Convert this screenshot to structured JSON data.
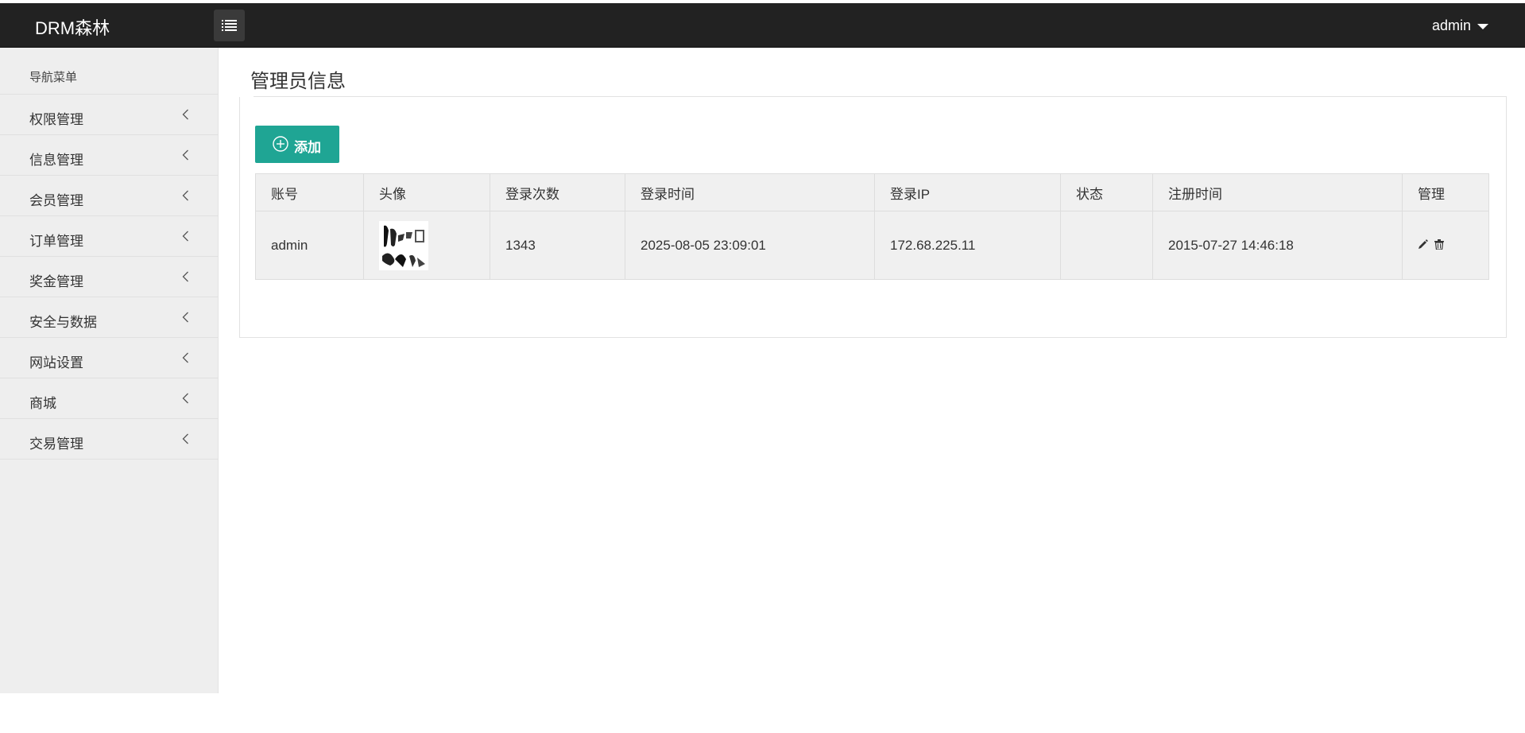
{
  "app": {
    "brand": "DRM森林",
    "user": "admin"
  },
  "sidebar": {
    "header": "导航菜单",
    "items": [
      {
        "label": "权限管理"
      },
      {
        "label": "信息管理"
      },
      {
        "label": "会员管理"
      },
      {
        "label": "订单管理"
      },
      {
        "label": "奖金管理"
      },
      {
        "label": "安全与数据"
      },
      {
        "label": "网站设置"
      },
      {
        "label": "商城"
      },
      {
        "label": "交易管理"
      }
    ]
  },
  "main": {
    "title": "管理员信息",
    "add_label": "添加",
    "table": {
      "headers": [
        "账号",
        "头像",
        "登录次数",
        "登录时间",
        "登录IP",
        "状态",
        "注册时间",
        "管理"
      ],
      "rows": [
        {
          "account": "admin",
          "avatar": "",
          "login_count": "1343",
          "login_time": "2025-08-05 23:09:01",
          "login_ip": "172.68.225.11",
          "status": "",
          "register_time": "2015-07-27 14:46:18"
        }
      ]
    }
  },
  "icons": [
    "menu-toggle-icon",
    "caret-down-icon",
    "chevron-left-icon",
    "plus-circle-icon",
    "pencil-icon",
    "trash-icon"
  ],
  "colors": {
    "topbar": "#222222",
    "accent": "#1fa594",
    "sidebar": "#eeeeee"
  }
}
